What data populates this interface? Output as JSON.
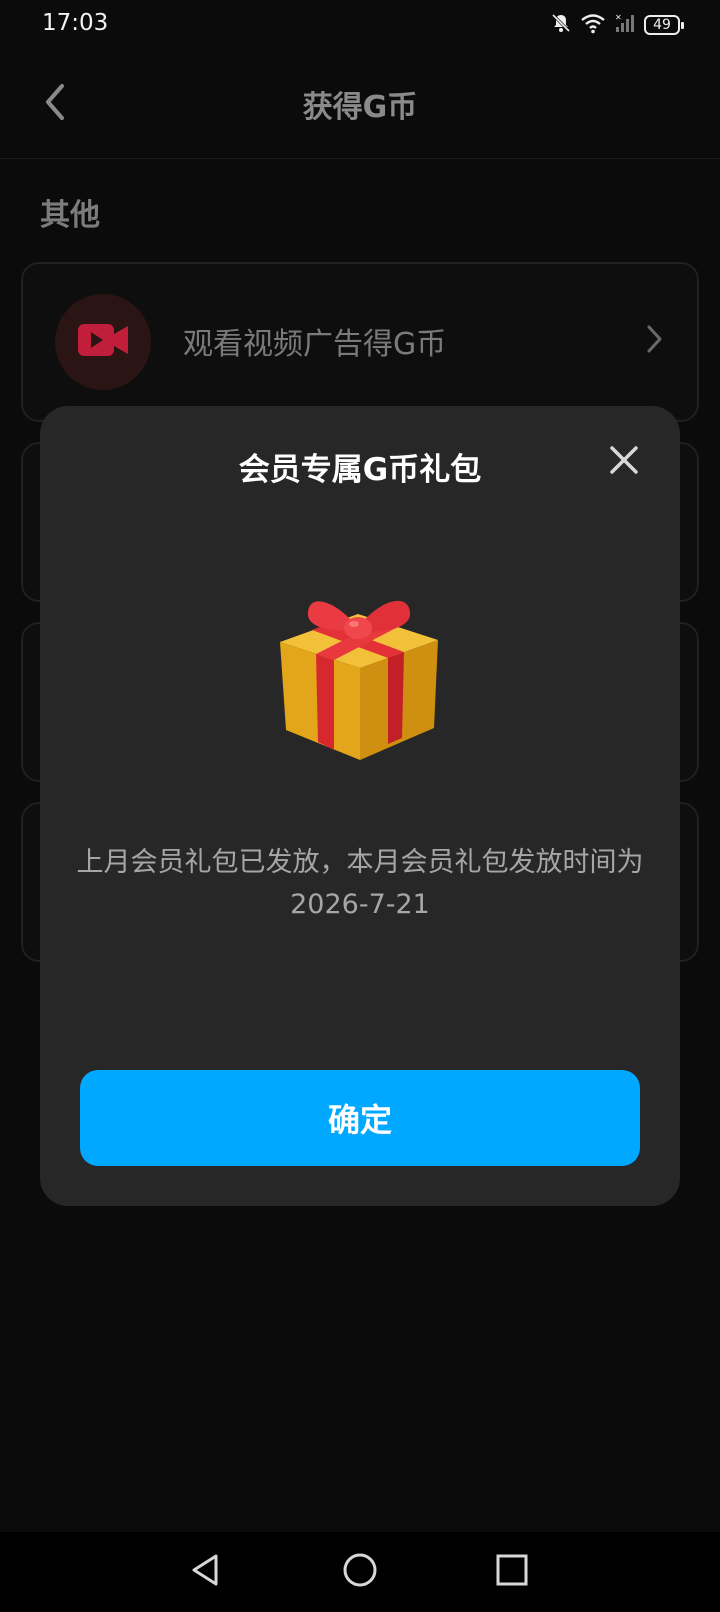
{
  "status_bar": {
    "time": "17:03",
    "battery": "49"
  },
  "header": {
    "title": "获得G币"
  },
  "section": {
    "title": "其他"
  },
  "list": {
    "items": [
      {
        "label": "观看视频广告得G币",
        "icon": "video-icon"
      }
    ]
  },
  "modal": {
    "title": "会员专属G币礼包",
    "message": "上月会员礼包已发放，本月会员礼包发放时间为2026-7-21",
    "confirm_label": "确定"
  },
  "colors": {
    "accent": "#00a8ff",
    "video_icon": "#c01e3a",
    "modal_bg": "#272727"
  }
}
